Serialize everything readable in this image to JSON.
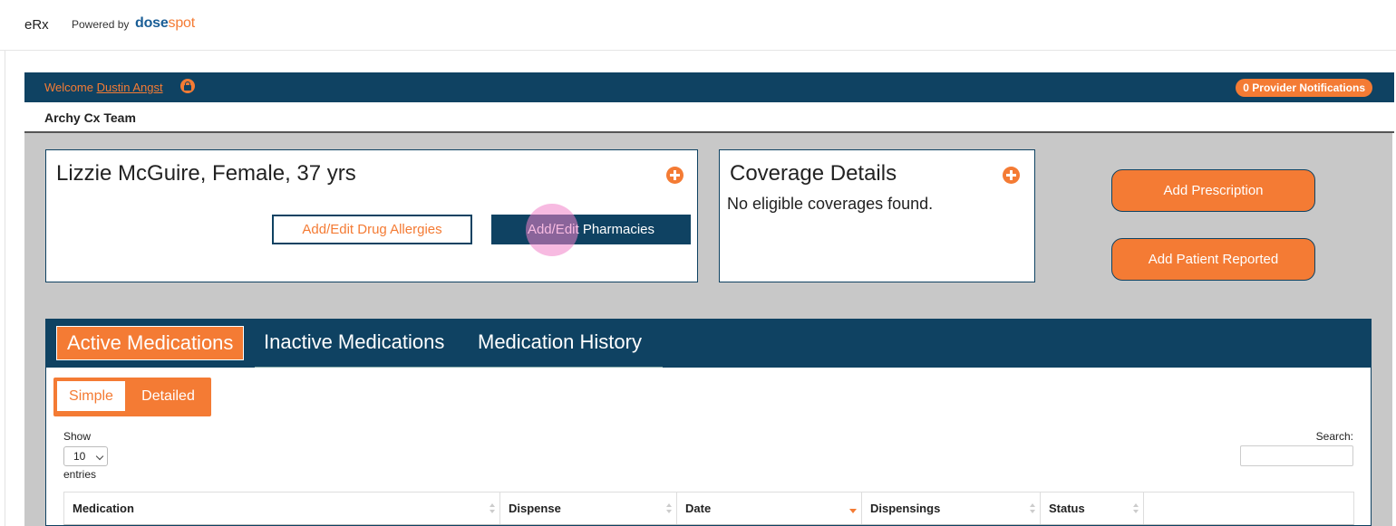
{
  "header": {
    "app_title": "eRx",
    "powered_by": "Powered by",
    "logo_dose": "dose",
    "logo_spot": "spot"
  },
  "welcome": {
    "prefix": "Welcome",
    "user_name": "Dustin Angst",
    "notifications": "0 Provider Notifications"
  },
  "team": {
    "name": "Archy Cx Team"
  },
  "patient": {
    "summary": "Lizzie McGuire, Female, 37 yrs",
    "allergies_button": "Add/Edit Drug Allergies",
    "pharmacies_button": "Add/Edit Pharmacies"
  },
  "coverage": {
    "title": "Coverage Details",
    "message": "No eligible coverages found."
  },
  "actions": {
    "add_prescription": "Add Prescription",
    "add_patient_reported": "Add Patient Reported"
  },
  "meds": {
    "tabs": [
      {
        "label": "Active Medications",
        "active": true
      },
      {
        "label": "Inactive Medications",
        "active": false
      },
      {
        "label": "Medication History",
        "active": false
      }
    ],
    "view_toggle": {
      "simple": "Simple",
      "detailed": "Detailed",
      "selected": "Detailed"
    },
    "show_label": "Show",
    "page_size": "10",
    "entries_label": "entries",
    "search_label": "Search:",
    "search_value": "",
    "columns": [
      "Medication",
      "Dispense",
      "Date",
      "Dispensings",
      "Status",
      ""
    ],
    "sort_column": "Date",
    "sort_direction": "desc"
  },
  "colors": {
    "navy": "#0f4262",
    "orange": "#f47b34",
    "panel_gray": "#c8c8c8"
  }
}
